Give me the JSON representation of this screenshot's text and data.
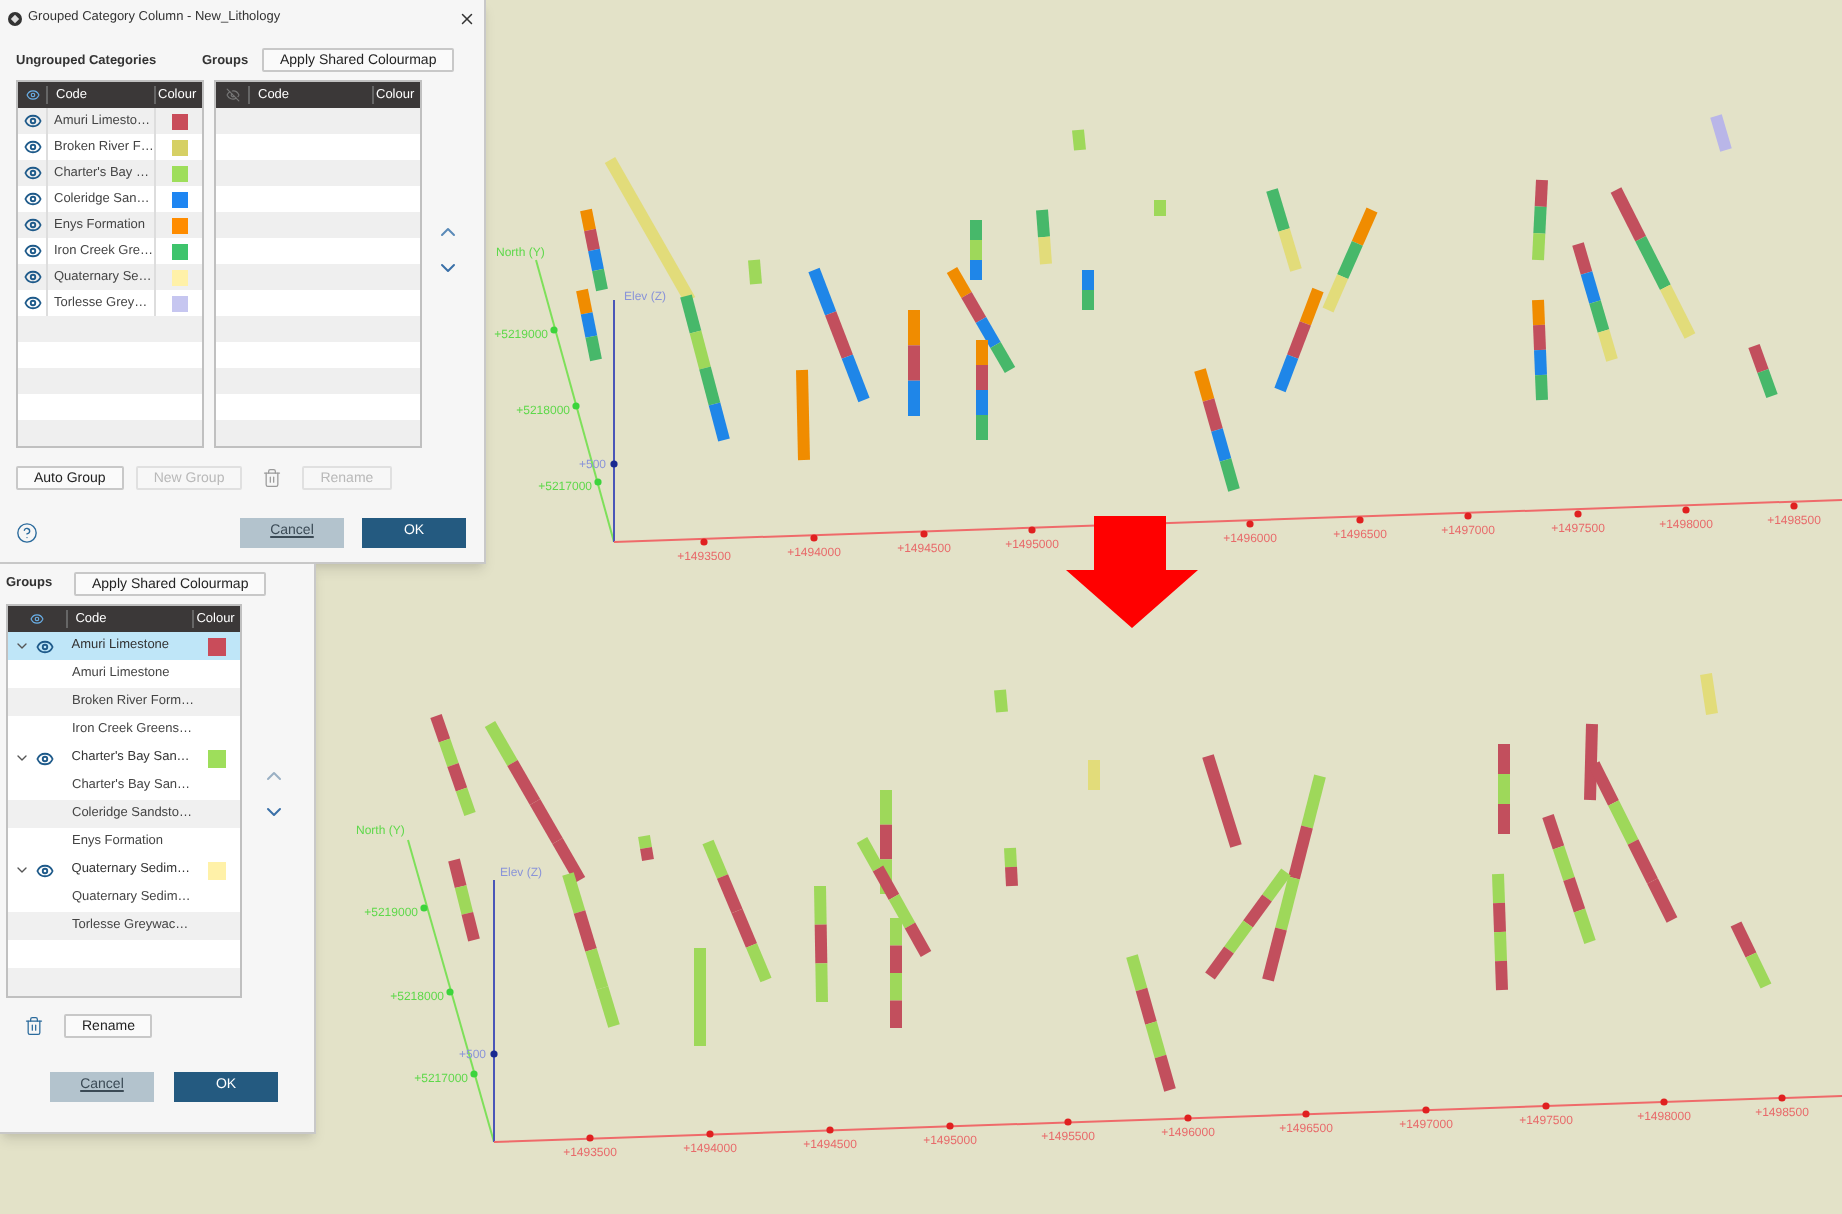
{
  "top_dialog": {
    "title": "Grouped Category Column - New_Lithology",
    "ungrouped": {
      "label": "Ungrouped Categories",
      "columns": [
        "Code",
        "Colour"
      ],
      "rows": [
        {
          "code": "Amuri Limesto…",
          "color": "#c94c5a",
          "visible": true
        },
        {
          "code": "Broken River F…",
          "color": "#d6d064",
          "visible": true
        },
        {
          "code": "Charter's Bay …",
          "color": "#9ede5b",
          "visible": true
        },
        {
          "code": "Coleridge San…",
          "color": "#1e86f2",
          "visible": true
        },
        {
          "code": "Enys Formation",
          "color": "#ff8c00",
          "visible": true
        },
        {
          "code": "Iron Creek Gre…",
          "color": "#3ec46c",
          "visible": true
        },
        {
          "code": "Quaternary Se…",
          "color": "#fff1a8",
          "visible": true
        },
        {
          "code": "Torlesse Grey…",
          "color": "#c6c6f0",
          "visible": true
        }
      ]
    },
    "groups": {
      "label": "Groups",
      "apply_button": "Apply Shared Colourmap",
      "columns": [
        "Code",
        "Colour"
      ]
    },
    "actions": [
      {
        "kind": "button",
        "label": "Auto Group",
        "disabled": false
      },
      {
        "kind": "button",
        "label": "New Group",
        "disabled": true
      },
      {
        "kind": "delete",
        "disabled": true
      },
      {
        "kind": "button",
        "label": "Rename",
        "disabled": true
      }
    ],
    "cancel": "Cancel",
    "ok": "OK"
  },
  "bottom_dialog": {
    "groups_label": "Groups",
    "apply_button": "Apply Shared Colourmap",
    "columns": [
      "Code",
      "Colour"
    ],
    "groups": [
      {
        "name": "Amuri Limestone",
        "color": "#c94c5a",
        "visible": true,
        "expanded": true,
        "selected": true,
        "children": [
          {
            "name": "Amuri Limestone",
            "selected": false
          },
          {
            "name": "Broken River Form…",
            "selected": false
          },
          {
            "name": "Iron Creek Greens…",
            "selected": false
          }
        ]
      },
      {
        "name": "Charter's Bay San…",
        "color": "#9ede5b",
        "visible": true,
        "expanded": true,
        "selected": false,
        "children": [
          {
            "name": "Charter's Bay San…",
            "selected": false
          },
          {
            "name": "Coleridge Sandsto…",
            "selected": false
          },
          {
            "name": "Enys Formation",
            "selected": false
          }
        ]
      },
      {
        "name": "Quaternary Sedim…",
        "color": "#fff1a8",
        "visible": true,
        "expanded": true,
        "selected": false,
        "children": [
          {
            "name": "Quaternary Sedim…",
            "selected": false
          },
          {
            "name": "Torlesse Greywac…",
            "selected": false
          }
        ]
      }
    ],
    "actions": [
      {
        "kind": "delete",
        "disabled": false
      },
      {
        "kind": "button",
        "label": "Rename",
        "disabled": false
      }
    ],
    "cancel": "Cancel",
    "ok": "OK"
  },
  "views": [
    {
      "north_label": "North (Y)",
      "north_ticks": [
        "+5219000",
        "+5218000",
        "+5217000"
      ],
      "elev_label": "Elev (Z)",
      "elev_tick": "+500",
      "east_ticks": [
        "+1493500",
        "+1494000",
        "+1494500",
        "+1495000",
        "+1496000",
        "+1496500",
        "+1497000",
        "+1497500",
        "+1498000",
        "+1498500"
      ]
    },
    {
      "north_label": "North (Y)",
      "north_ticks": [
        "+5219000",
        "+5218000",
        "+5217000"
      ],
      "elev_label": "Elev (Z)",
      "elev_tick": "+500",
      "east_ticks": [
        "+1493500",
        "+1494000",
        "+1494500",
        "+1495000",
        "+1495500",
        "+1496000",
        "+1496500",
        "+1497000",
        "+1497500",
        "+1498000",
        "+1498500"
      ]
    }
  ]
}
